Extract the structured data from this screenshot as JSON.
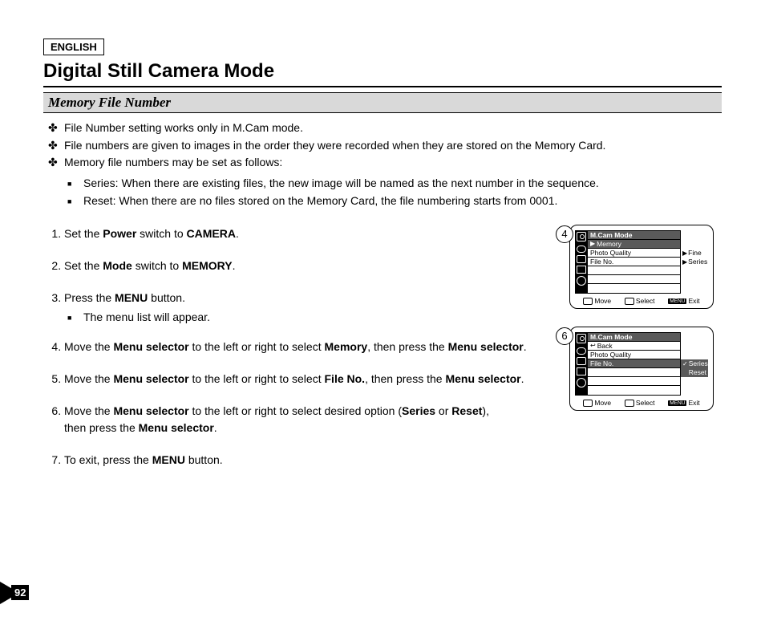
{
  "language_label": "ENGLISH",
  "page_title": "Digital Still Camera Mode",
  "section_title": "Memory File Number",
  "notes": {
    "n1": "File Number setting works only in M.Cam mode.",
    "n2": "File numbers are given to images in the order they were recorded when they are stored on the Memory Card.",
    "n3": "Memory file numbers may be set as follows:",
    "s1": "Series: When there are existing files, the new image will be named as the next number in the sequence.",
    "s2": "Reset: When there are no files stored on the Memory Card, the file numbering starts from 0001."
  },
  "steps": {
    "st1a": "Set the ",
    "st1b": "Power",
    "st1c": " switch to ",
    "st1d": "CAMERA",
    "st1e": ".",
    "st2a": "Set the ",
    "st2b": "Mode",
    "st2c": " switch to ",
    "st2d": "MEMORY",
    "st2e": ".",
    "st3a": "Press the ",
    "st3b": "MENU",
    "st3c": " button.",
    "st3sub": "The menu list will appear.",
    "st4a": "Move the ",
    "st4b": "Menu selector",
    "st4c": " to the left or right to select ",
    "st4d": "Memory",
    "st4e": ", then press the ",
    "st4f": "Menu selector",
    "st4g": ".",
    "st5a": "Move the ",
    "st5b": "Menu selector",
    "st5c": " to the left or right to select ",
    "st5d": "File No.",
    "st5e": ", then press the ",
    "st5f": "Menu selector",
    "st5g": ".",
    "st6a": "Move the ",
    "st6b": "Menu selector",
    "st6c": " to the left or right to select desired option (",
    "st6d": "Series",
    "st6e": " or ",
    "st6f": "Reset",
    "st6g": "),",
    "st6h": "then press the ",
    "st6i": "Menu selector",
    "st6j": ".",
    "st7a": "To exit, press the ",
    "st7b": "MENU",
    "st7c": " button."
  },
  "screen4": {
    "badge": "4",
    "header": "M.Cam Mode",
    "row1": "Memory",
    "row2": "Photo Quality",
    "row3": "File No.",
    "opt1": "Fine",
    "opt2": "Series"
  },
  "screen6": {
    "badge": "6",
    "header": "M.Cam Mode",
    "row1": "Back",
    "row2": "Photo Quality",
    "row3": "File No.",
    "opt1": "Series",
    "opt2": "Reset"
  },
  "footer": {
    "move": "Move",
    "select": "Select",
    "menu": "MENU",
    "exit": "Exit"
  },
  "page_number": "92"
}
